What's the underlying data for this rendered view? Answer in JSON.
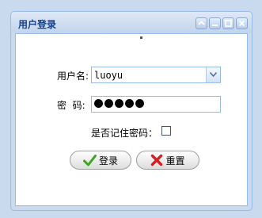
{
  "window": {
    "title": "用户登录",
    "tools": [
      "help-icon",
      "minimize-icon",
      "maximize-icon",
      "close-icon"
    ]
  },
  "form": {
    "username_label": "用户名:",
    "username_value": "luoyu",
    "password_label": "密  码:",
    "password_mask_count": 5,
    "remember_label": "是否记住密码：",
    "remember_checked": false
  },
  "buttons": {
    "login_label": "登录",
    "reset_label": "重置"
  },
  "colors": {
    "title": "#15428b",
    "border": "#99bbe8",
    "login_icon": "#3fa51f",
    "reset_icon": "#d81f1f"
  }
}
